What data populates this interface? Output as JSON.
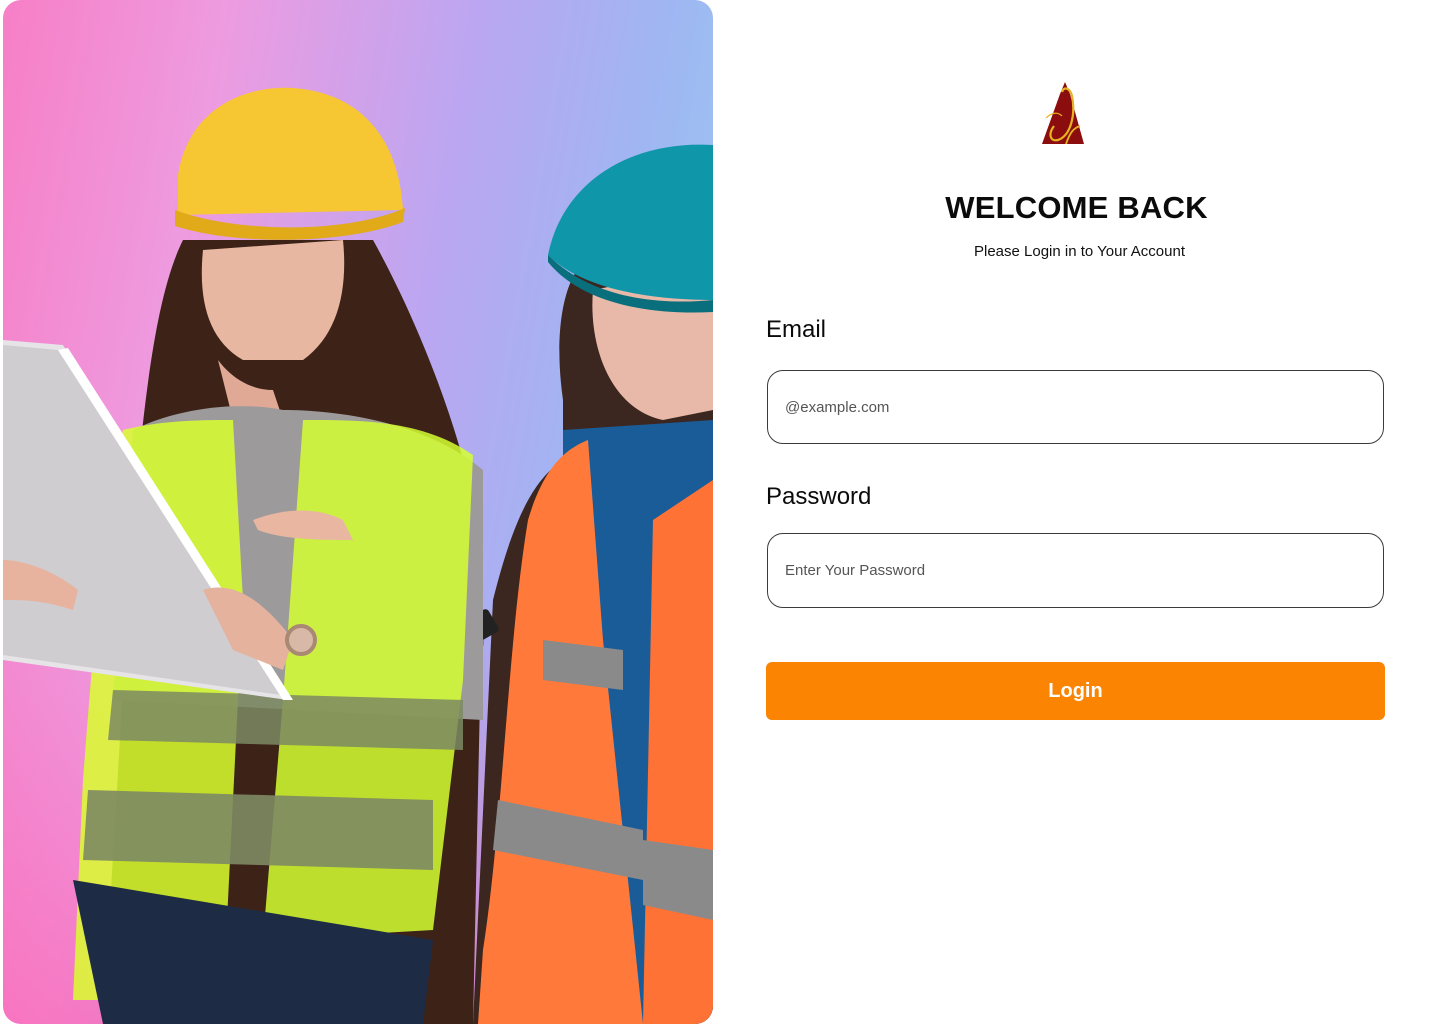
{
  "hero": {
    "image_alt": "Two women in hard hats and safety vests reviewing a document"
  },
  "brand": {
    "logo_icon": "brand-logo-icon",
    "logo_primary_color": "#8b0d0d",
    "logo_accent_color": "#e6b422"
  },
  "login": {
    "title": "WELCOME BACK",
    "subtitle": "Please Login in to Your Account",
    "email_label": "Email",
    "email_placeholder": "@example.com",
    "password_label": "Password",
    "password_placeholder": "Enter Your Password",
    "submit_label": "Login",
    "accent_color": "#fb8503"
  }
}
